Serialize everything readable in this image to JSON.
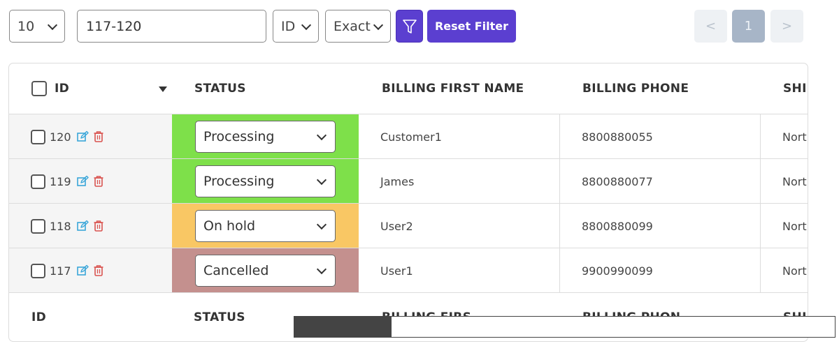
{
  "toolbar": {
    "per_page": "10",
    "search_value": "117-120",
    "field": "ID",
    "match": "Exact",
    "reset_label": "Reset Filter"
  },
  "pagination": {
    "prev": "<",
    "current": "1",
    "next": ">"
  },
  "table": {
    "headers": {
      "id": "ID",
      "status": "STATUS",
      "billing_first_name": "BILLING FIRST NAME",
      "billing_phone": "BILLING PHONE",
      "shipping": "SHI"
    },
    "footers": {
      "id": "ID",
      "status": "STATUS",
      "billing_first_name": "BILLING FIRS",
      "billing_phone": "BILLING PHON",
      "shipping": "SHI"
    },
    "rows": [
      {
        "id": "120",
        "status": "Processing",
        "status_color": "#7ee04a",
        "first_name": "Customer1",
        "phone": "8800880055",
        "ship": "Nort"
      },
      {
        "id": "119",
        "status": "Processing",
        "status_color": "#7ee04a",
        "first_name": "James",
        "phone": "8800880077",
        "ship": "Nort"
      },
      {
        "id": "118",
        "status": "On hold",
        "status_color": "#f9c764",
        "first_name": "User2",
        "phone": "8800880099",
        "ship": "Nort"
      },
      {
        "id": "117",
        "status": "Cancelled",
        "status_color": "#c4908e",
        "first_name": "User1",
        "phone": "9900990099",
        "ship": "Nort"
      }
    ]
  },
  "colors": {
    "accent": "#5b3fd0",
    "edit_icon": "#3aa6d9",
    "delete_icon": "#d9534f"
  },
  "scroll": {
    "position": 0.18
  }
}
